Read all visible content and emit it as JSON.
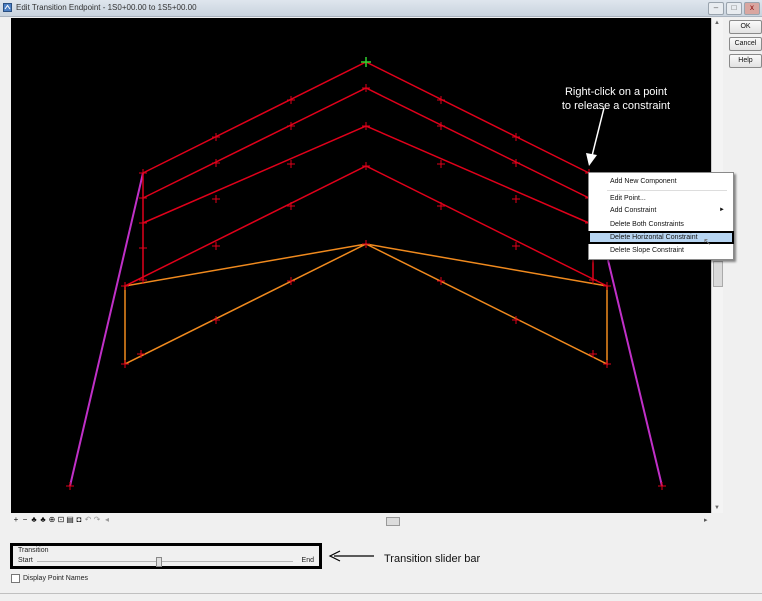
{
  "window": {
    "title": "Edit Transition Endpoint - 1S0+00.00 to 1S5+00.00",
    "controls": [
      "–",
      "□",
      "x"
    ]
  },
  "buttons": {
    "ok": "OK",
    "cancel": "Cancel",
    "help": "Help"
  },
  "annotations": {
    "callout_line1": "Right-click on a point",
    "callout_line2": "to release a constraint",
    "slider_caption": "Transition slider bar"
  },
  "context_menu": {
    "items": [
      "Add New Component",
      "Edit Point...",
      "Add Constraint",
      "Delete Both Constraints",
      "Delete Horizontal Constraint",
      "Delete Slope Constraint"
    ],
    "selected": "Delete Horizontal Constraint"
  },
  "transition": {
    "group_title": "Transition",
    "start_label": "Start",
    "end_label": "End",
    "value": 0.5
  },
  "options": {
    "display_point_names_label": "Display Point Names",
    "display_point_names_checked": false
  },
  "toolbar_icons": [
    "add-icon",
    "remove-icon",
    "point-icon",
    "move-icon",
    "zoom-icon",
    "fit-icon",
    "grid-icon",
    "undo-icon",
    "redo-icon"
  ],
  "colors": {
    "canvas_bg": "#000000",
    "layer_lines": "#e0001a",
    "base_layer": "#f08a1e",
    "side_slopes": "#c030c8",
    "apex_point": "#2fd12f",
    "menu_highlight": "#b7d5f2"
  }
}
